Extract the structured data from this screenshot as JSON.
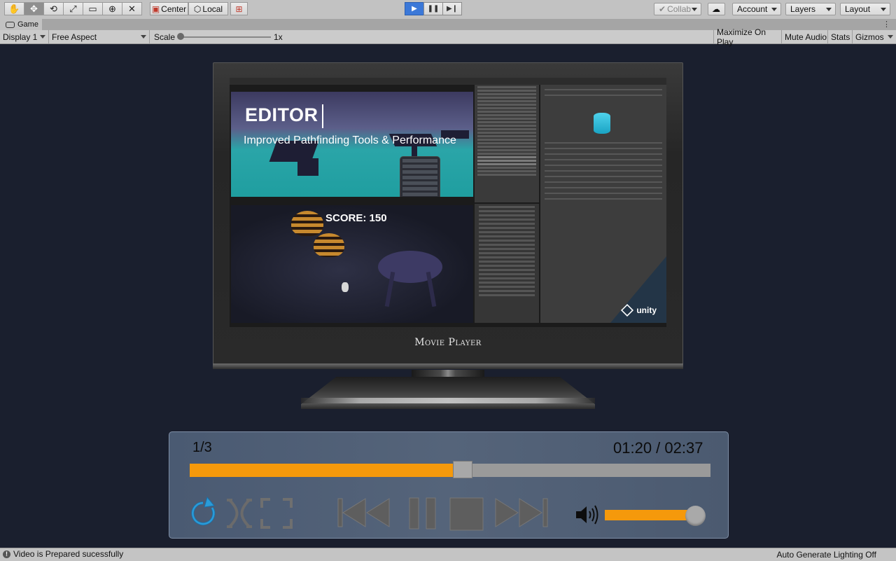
{
  "toolbar": {
    "tools": [
      "hand-tool",
      "move-tool",
      "rotate-tool",
      "scale-tool",
      "rect-tool",
      "transform-tool",
      "custom-tool"
    ],
    "pivot_label": "Center",
    "space_label": "Local",
    "collab_label": "Collab",
    "account_label": "Account",
    "layers_label": "Layers",
    "layout_label": "Layout"
  },
  "game_tab": {
    "label": "Game"
  },
  "game_controls": {
    "display": "Display 1",
    "aspect": "Free Aspect",
    "scale_label": "Scale",
    "scale_value": "1x",
    "maximize": "Maximize On Play",
    "mute": "Mute Audio",
    "stats": "Stats",
    "gizmos": "Gizmos"
  },
  "video_frame": {
    "title": "EDITOR",
    "subtitle": "Improved Pathfinding Tools & Performance",
    "score": "SCORE: 150",
    "brand": "unity"
  },
  "tv_label": "Movie Player",
  "player": {
    "counter": "1/3",
    "time": "01:20 / 02:37",
    "progress": 0.524,
    "volume": 0.87
  },
  "colors": {
    "accent_orange": "#f5990b",
    "panel_bg": "#55647a",
    "loop_blue": "#2a9bd8",
    "play_blue": "#3b78d8"
  },
  "status": {
    "message": "Video is Prepared sucessfully",
    "lighting": "Auto Generate Lighting Off"
  }
}
